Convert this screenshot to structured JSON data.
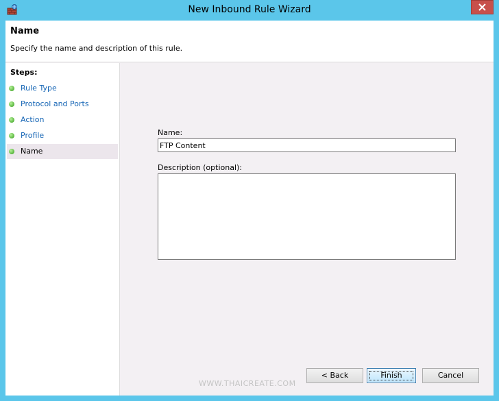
{
  "window": {
    "title": "New Inbound Rule Wizard",
    "close_glyph": "✕",
    "accent_color": "#5bc6ea",
    "close_color": "#c7504b"
  },
  "header": {
    "title": "Name",
    "subtitle": "Specify the name and description of this rule."
  },
  "steps": {
    "label": "Steps:",
    "items": [
      {
        "label": "Rule Type"
      },
      {
        "label": "Protocol and Ports"
      },
      {
        "label": "Action"
      },
      {
        "label": "Profile"
      },
      {
        "label": "Name"
      }
    ],
    "current": "Name"
  },
  "form": {
    "name_label": "Name:",
    "name_value": "FTP Content",
    "description_label": "Description (optional):",
    "description_value": ""
  },
  "watermark": "WWW.THAICREATE.COM",
  "buttons": {
    "back": "< Back",
    "finish": "Finish",
    "cancel": "Cancel"
  }
}
